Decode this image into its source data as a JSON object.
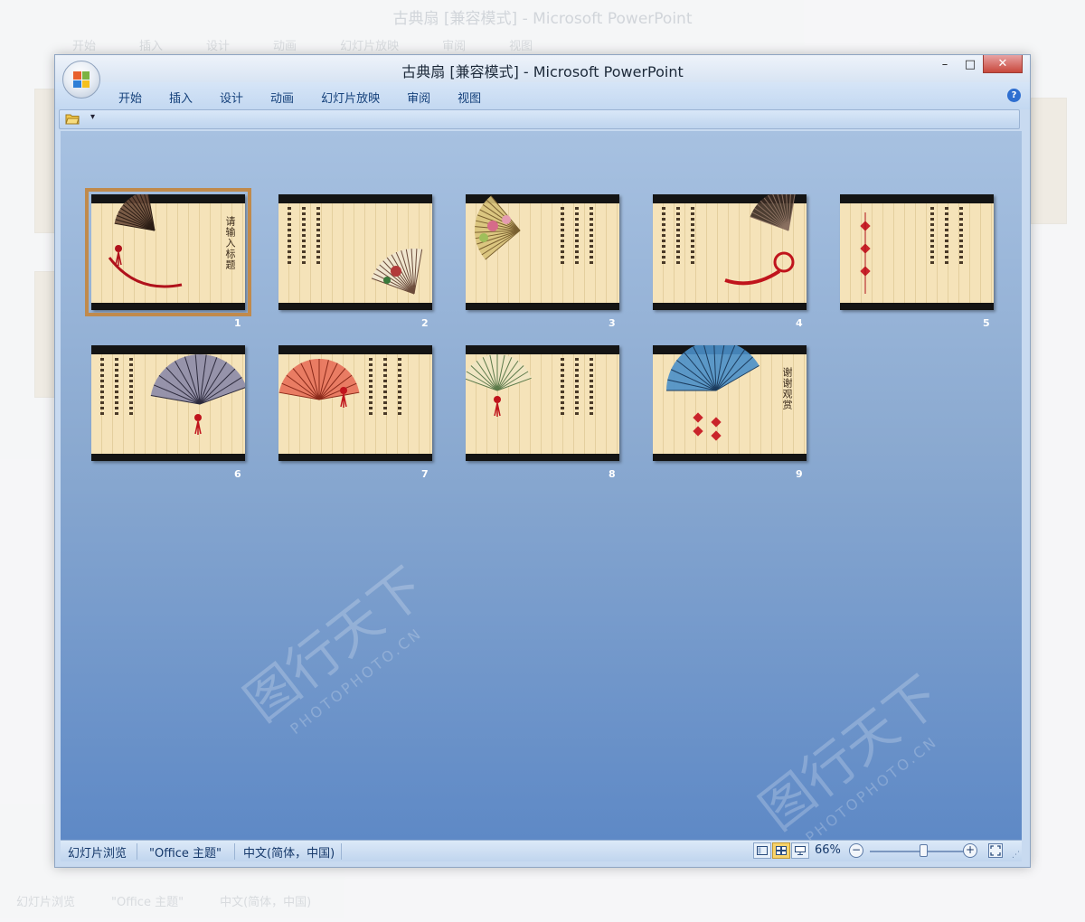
{
  "app": {
    "title": "古典扇 [兼容模式] - Microsoft PowerPoint",
    "controls": {
      "minimize": "–",
      "maximize": "□",
      "close": "✕"
    }
  },
  "ribbon": {
    "tabs": [
      "开始",
      "插入",
      "设计",
      "动画",
      "幻灯片放映",
      "审阅",
      "视图"
    ],
    "help": "?"
  },
  "qat": {
    "dropdown": "▾"
  },
  "slides": [
    {
      "number": "1",
      "title": "请输入标题",
      "selected": true
    },
    {
      "number": "2"
    },
    {
      "number": "3"
    },
    {
      "number": "4"
    },
    {
      "number": "5"
    },
    {
      "number": "6"
    },
    {
      "number": "7"
    },
    {
      "number": "8"
    },
    {
      "number": "9",
      "title": "谢谢观赏"
    }
  ],
  "status": {
    "view_name": "幻灯片浏览",
    "theme": "\"Office 主题\"",
    "language": "中文(简体，中国)",
    "zoom": "66%",
    "zoom_out": "−",
    "zoom_in": "+"
  },
  "watermark": {
    "text": "图行天下",
    "sub": "PHOTOPHOTO.CN"
  },
  "colors": {
    "accent": "#c08a4c",
    "sorter_bg": "#6f95c9",
    "slide_paper": "#f5e3b9"
  }
}
